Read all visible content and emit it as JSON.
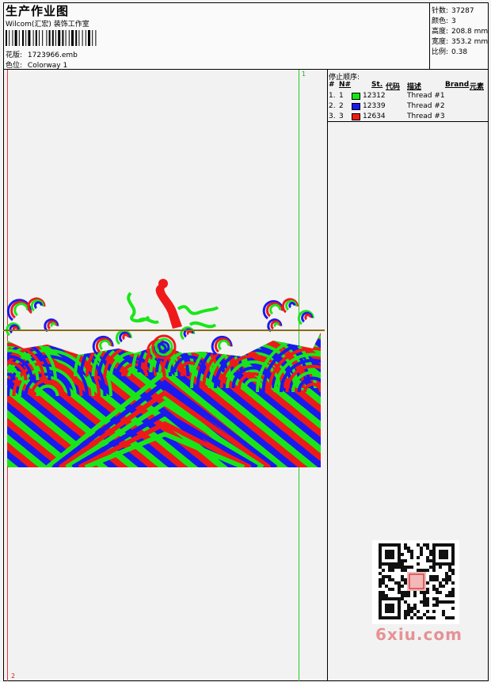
{
  "header": {
    "title": "生产作业图",
    "company": "Wilcom(汇宏) 装饰工作室",
    "design_label": "花版:",
    "design_value": "1723966.emb",
    "colorway_label": "色位:",
    "colorway_value": "Colorway 1"
  },
  "stats": [
    {
      "label": "针数:",
      "value": "37287"
    },
    {
      "label": "颜色:",
      "value": "3"
    },
    {
      "label": "高度:",
      "value": "208.8 mm"
    },
    {
      "label": "宽度:",
      "value": "353.2 mm"
    },
    {
      "label": "比例:",
      "value": "0.38"
    }
  ],
  "stop_sequence": {
    "title": "停止顺序:",
    "columns": [
      "#",
      "N#",
      "St.",
      "代码",
      "描述",
      "Brand",
      "元素"
    ],
    "rows": [
      {
        "index": "1.",
        "n": "1",
        "color": "#19e619",
        "code": "12312",
        "desc": "Thread #1"
      },
      {
        "index": "2.",
        "n": "2",
        "color": "#1a1aee",
        "code": "12339",
        "desc": "Thread #2"
      },
      {
        "index": "3.",
        "n": "3",
        "color": "#ee1a1a",
        "code": "12634",
        "desc": "Thread #3"
      }
    ]
  },
  "markers": {
    "top": "1",
    "bottom": "2"
  },
  "watermark": "6xiu.com",
  "colors": {
    "green": "#19e619",
    "blue": "#1a1aee",
    "red": "#ee1a1a"
  }
}
